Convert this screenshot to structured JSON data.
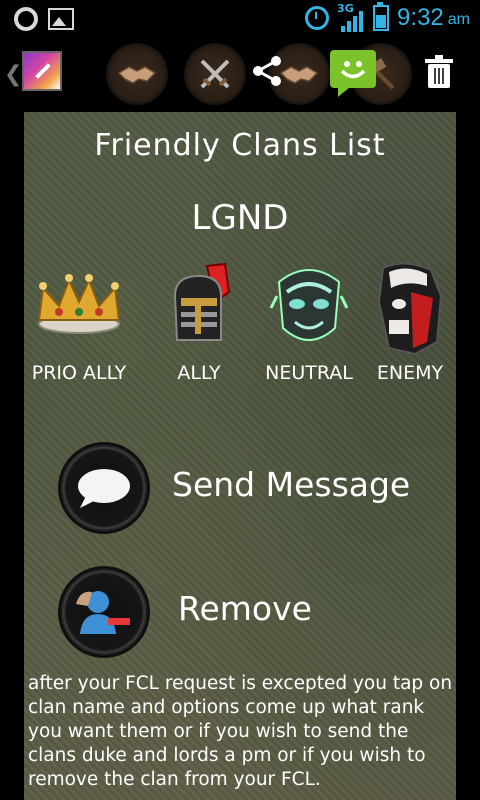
{
  "status_bar": {
    "network": "3G",
    "time": "9:32",
    "ampm": "am",
    "icons": [
      "notification-o-icon",
      "gallery-icon",
      "alarm-icon",
      "signal-icon",
      "battery-icon"
    ]
  },
  "toolbar": {
    "icons": [
      "back-chevron-icon",
      "app-icon",
      "handshake-icon",
      "crossed-swords-icon",
      "share-icon",
      "handshake-icon",
      "sms-smiley-icon",
      "hammer-icon",
      "trash-icon"
    ]
  },
  "page": {
    "title": "Friendly Clans List",
    "clan_name": "LGND"
  },
  "ranks": [
    {
      "label": "PRIO ALLY",
      "icon": "crown-icon"
    },
    {
      "label": "ALLY",
      "icon": "knight-helmet-icon"
    },
    {
      "label": "NEUTRAL",
      "icon": "mask-icon"
    },
    {
      "label": "ENEMY",
      "icon": "demon-mask-icon"
    }
  ],
  "actions": {
    "send_message": "Send Message",
    "remove": "Remove"
  },
  "footnote": "after your FCL request is excepted you tap on clan name and options come up what rank you want them or if you wish to send the clans duke and lords a pm or if you wish to remove the clan from your FCL.",
  "colors": {
    "status_accent": "#33b5e5",
    "sms_green": "#7cc22a",
    "text": "#ffffff"
  }
}
